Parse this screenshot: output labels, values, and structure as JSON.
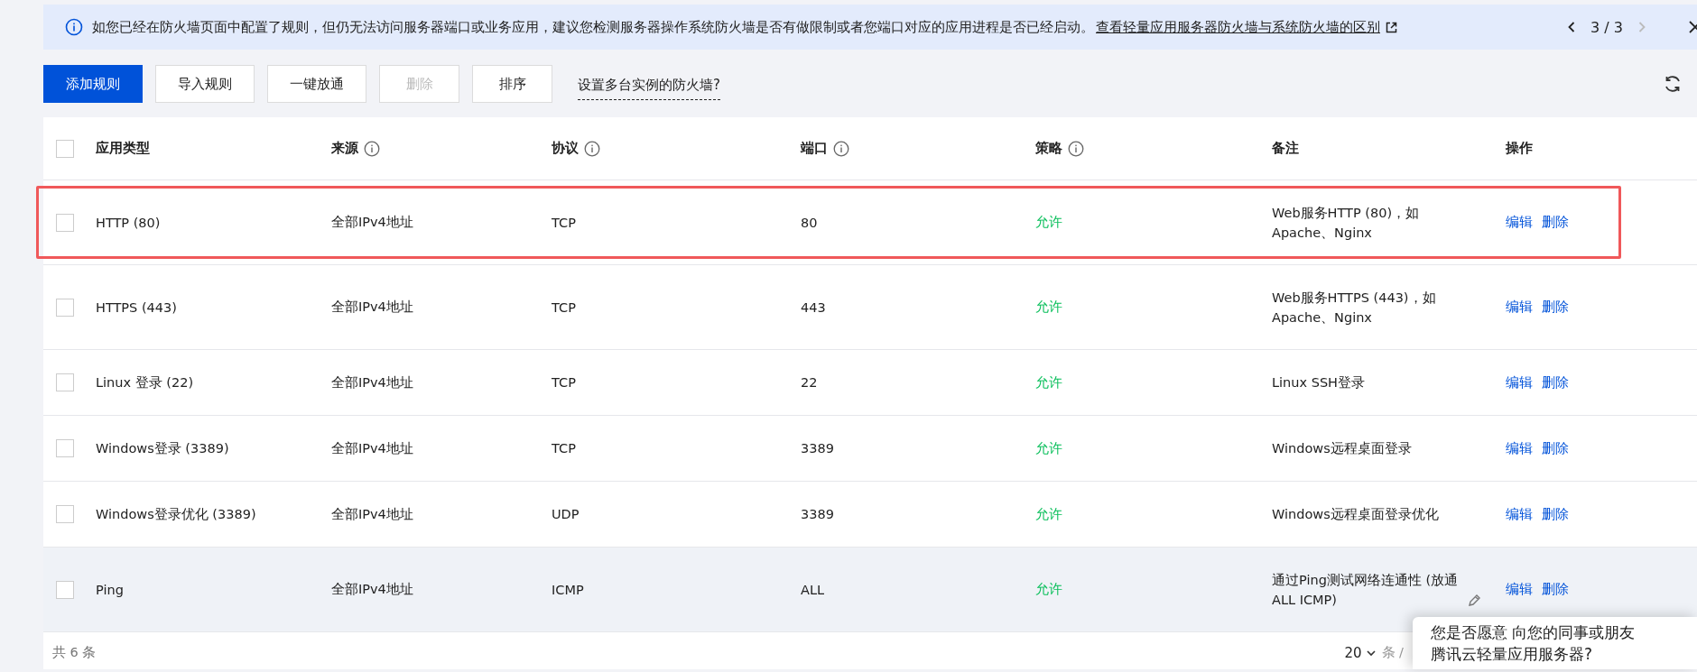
{
  "notice": {
    "text": "如您已经在防火墙页面中配置了规则，但仍无法访问服务器端口或业务应用，建议您检测服务器操作系统防火墙是否有做限制或者您端口对应的应用进程是否已经启动。",
    "link": "查看轻量应用服务器防火墙与系统防火墙的区别",
    "pager": "3 / 3"
  },
  "toolbar": {
    "buttons": [
      {
        "label": "添加规则",
        "kind": "primary",
        "disabled": false
      },
      {
        "label": "导入规则",
        "kind": "default",
        "disabled": false
      },
      {
        "label": "一键放通",
        "kind": "default",
        "disabled": false
      },
      {
        "label": "删除",
        "kind": "default",
        "disabled": true
      },
      {
        "label": "排序",
        "kind": "default",
        "disabled": false
      }
    ],
    "link": "设置多台实例的防火墙?"
  },
  "table": {
    "select_all_checked": false,
    "columns": [
      {
        "label": "应用类型",
        "info": false
      },
      {
        "label": "来源",
        "info": true
      },
      {
        "label": "协议",
        "info": true
      },
      {
        "label": "端口",
        "info": true
      },
      {
        "label": "策略",
        "info": true
      },
      {
        "label": "备注",
        "info": false
      },
      {
        "label": "操作",
        "info": false
      }
    ],
    "rows": [
      {
        "type": "HTTP (80)",
        "source": "全部IPv4地址",
        "protocol": "TCP",
        "port": "80",
        "policy": "允许",
        "remark": "Web服务HTTP (80)，如Apache、Nginx",
        "actions": [
          "编辑",
          "删除"
        ],
        "checked": false,
        "highlighted": true,
        "hovered": false,
        "editable_remark": false
      },
      {
        "type": "HTTPS (443)",
        "source": "全部IPv4地址",
        "protocol": "TCP",
        "port": "443",
        "policy": "允许",
        "remark": "Web服务HTTPS (443)，如Apache、Nginx",
        "actions": [
          "编辑",
          "删除"
        ],
        "checked": false,
        "highlighted": false,
        "hovered": false,
        "editable_remark": false
      },
      {
        "type": "Linux 登录 (22)",
        "source": "全部IPv4地址",
        "protocol": "TCP",
        "port": "22",
        "policy": "允许",
        "remark": "Linux SSH登录",
        "actions": [
          "编辑",
          "删除"
        ],
        "checked": false,
        "highlighted": false,
        "hovered": false,
        "editable_remark": false
      },
      {
        "type": "Windows登录 (3389)",
        "source": "全部IPv4地址",
        "protocol": "TCP",
        "port": "3389",
        "policy": "允许",
        "remark": "Windows远程桌面登录",
        "actions": [
          "编辑",
          "删除"
        ],
        "checked": false,
        "highlighted": false,
        "hovered": false,
        "editable_remark": false
      },
      {
        "type": "Windows登录优化 (3389)",
        "source": "全部IPv4地址",
        "protocol": "UDP",
        "port": "3389",
        "policy": "允许",
        "remark": "Windows远程桌面登录优化",
        "actions": [
          "编辑",
          "删除"
        ],
        "checked": false,
        "highlighted": false,
        "hovered": false,
        "editable_remark": false
      },
      {
        "type": "Ping",
        "source": "全部IPv4地址",
        "protocol": "ICMP",
        "port": "ALL",
        "policy": "允许",
        "remark": "通过Ping测试网络连通性 (放通ALL ICMP)",
        "actions": [
          "编辑",
          "删除"
        ],
        "checked": false,
        "highlighted": false,
        "hovered": true,
        "editable_remark": true
      }
    ]
  },
  "footer": {
    "total": "共 6 条",
    "page_size": "20",
    "unit": "条 /"
  },
  "survey": {
    "text": "您是否愿意 向您的同事或朋友",
    "text_2": "腾讯云轻量应用服务器?"
  }
}
